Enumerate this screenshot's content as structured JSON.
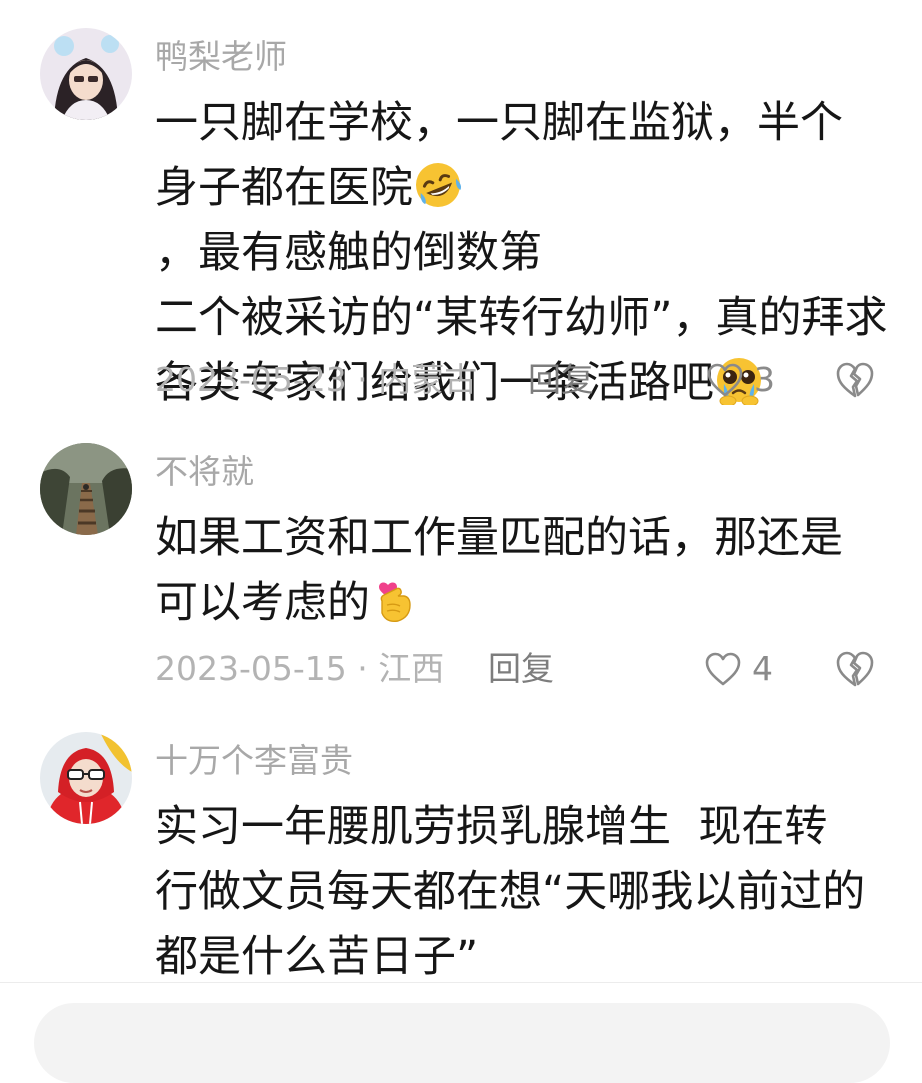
{
  "comments": [
    {
      "username": "鸭梨老师",
      "lines": [
        "一只脚在学校，一只脚在监狱，半个",
        "身子都在医院",
        "，最有感触的倒数第",
        "二个被采访的“某转行幼师”，真的拜求",
        "各类专家们给我们一条活路吧"
      ],
      "date": "2023-05-23",
      "location": "内蒙古",
      "reply_label": "回复",
      "likes": "3",
      "emoji_1": "rofl-emoji",
      "emoji_2": "pleading-tears-emoji"
    },
    {
      "username": "不将就",
      "lines": [
        "如果工资和工作量匹配的话，那还是",
        "可以考虑的"
      ],
      "date": "2023-05-15",
      "location": "江西",
      "reply_label": "回复",
      "likes": "4",
      "emoji_1": "finger-heart-emoji"
    },
    {
      "username": "十万个李富贵",
      "lines": [
        "实习一年腰肌劳损乳腺增生  现在转",
        "行做文员每天都在想“天哪我以前过的",
        "都是什么苦日子”"
      ]
    }
  ],
  "separator": "·",
  "colors": {
    "username": "#a8a8a8",
    "body_text": "#161616",
    "meta": "#b3b3b3",
    "icon": "#8a8a8a",
    "input_bg": "#f3f3f3"
  }
}
